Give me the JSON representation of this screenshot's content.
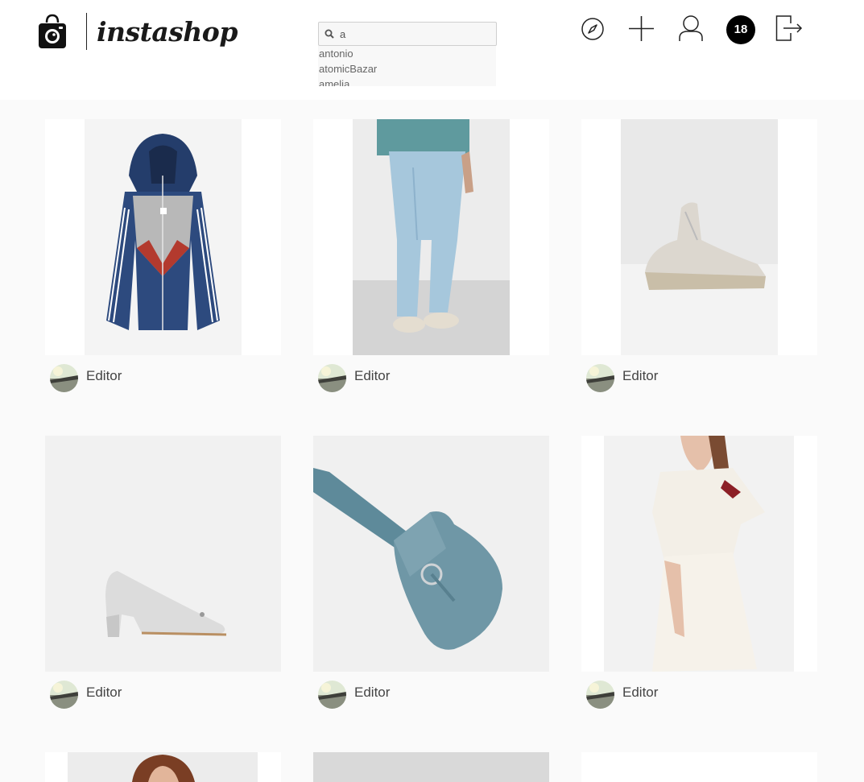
{
  "app": {
    "name": "instashop"
  },
  "search": {
    "value": "a",
    "suggestions": [
      "antonio",
      "atomicBazar",
      "amelia"
    ]
  },
  "nav": {
    "notifications_count": "18",
    "icons": [
      "compass-icon",
      "plus-icon",
      "user-icon",
      "logout-icon"
    ]
  },
  "feed": {
    "posts": [
      {
        "author": "Editor",
        "product": "hooded track jacket"
      },
      {
        "author": "Editor",
        "product": "light blue jeans"
      },
      {
        "author": "Editor",
        "product": "white knit sneaker"
      },
      {
        "author": "Editor",
        "product": "silver block heel pump"
      },
      {
        "author": "Editor",
        "product": "blue suede bag"
      },
      {
        "author": "Editor",
        "product": "white ruffled dress"
      },
      {
        "author": "",
        "product": "portrait photo"
      },
      {
        "author": "",
        "product": "grey photo"
      },
      {
        "author": "",
        "product": "white photo"
      }
    ]
  },
  "colors": {
    "background": "#fafafa",
    "header": "#ffffff",
    "badge": "#000000"
  }
}
